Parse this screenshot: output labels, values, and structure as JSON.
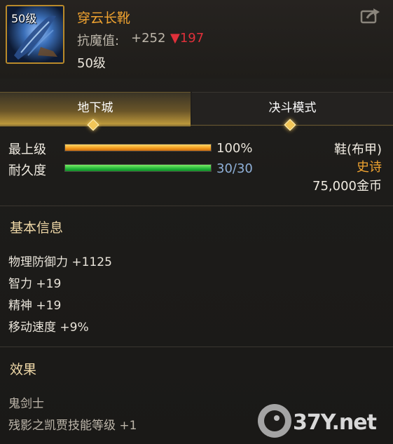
{
  "item": {
    "level_badge": "50级",
    "name": "穿云长靴",
    "resist_label": "抗魔值:",
    "resist_value": "+252",
    "resist_diff": "▼197",
    "level_text": "50级"
  },
  "tabs": [
    {
      "label": "地下城",
      "active": true
    },
    {
      "label": "决斗模式",
      "active": false
    }
  ],
  "stats": {
    "grade_label": "最上级",
    "grade_percent": 100,
    "grade_value": "100%",
    "durability_label": "耐久度",
    "durability_current": 30,
    "durability_max": 30,
    "durability_value": "30/30"
  },
  "meta": {
    "type": "鞋(布甲)",
    "rarity": "史诗",
    "price": "75,000金币"
  },
  "basic_info": {
    "title": "基本信息",
    "lines": [
      "物理防御力 +1125",
      "智力 +19",
      "精神 +19",
      "移动速度 +9%"
    ]
  },
  "effects": {
    "title": "效果",
    "lines": [
      "鬼剑士",
      "残影之凯贾技能等级 +1"
    ]
  },
  "watermark": {
    "text": "37Y.net"
  },
  "colors": {
    "name": "#f0a330",
    "rarity": "#f0a330",
    "diff_down": "#e0303a",
    "durability_value": "#8fb0d8",
    "tab_active": "#c8a23e"
  }
}
